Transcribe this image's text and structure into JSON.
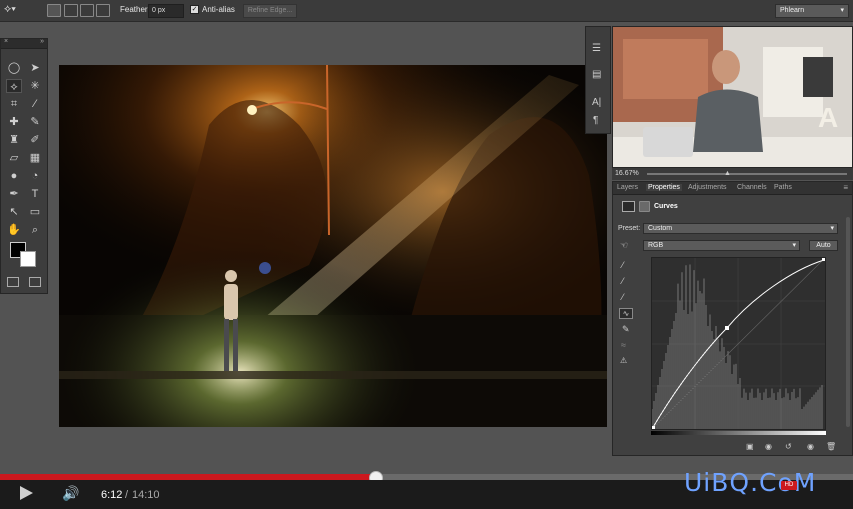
{
  "options_bar": {
    "feather_label": "Feather:",
    "feather_value": "0 px",
    "antialias_label": "Anti-alias",
    "refine_edge_label": "Refine Edge...",
    "workspace_value": "Phlearn"
  },
  "tools_panel": {
    "icons": [
      "marquee-icon",
      "move-icon",
      "polygonal-lasso-icon",
      "magic-wand-icon",
      "crop-icon",
      "eyedropper-icon",
      "healing-brush-icon",
      "brush-icon",
      "clone-stamp-icon",
      "history-brush-icon",
      "eraser-icon",
      "gradient-icon",
      "blur-icon",
      "dodge-icon",
      "pen-icon",
      "type-icon",
      "path-select-icon",
      "rectangle-icon",
      "hand-icon",
      "zoom-icon"
    ]
  },
  "video": {
    "zoom": "16.67%"
  },
  "properties_panel": {
    "tabs": [
      "Layers",
      "Properties",
      "Adjustments",
      "Channels",
      "Paths"
    ],
    "active_tab": "Properties",
    "title": "Curves",
    "preset_label": "Preset:",
    "preset_value": "Custom",
    "channel_value": "RGB",
    "auto_label": "Auto"
  },
  "player": {
    "current_time": "6:12",
    "separator": "/",
    "duration": "14:10",
    "progress_fraction": 0.441,
    "hd_badge": "HD"
  },
  "watermark": "UiBQ.CoM",
  "colors": {
    "progress": "#cc181e",
    "panel": "#404040",
    "workspace": "#535353",
    "watermark": "#6fa2ff"
  }
}
